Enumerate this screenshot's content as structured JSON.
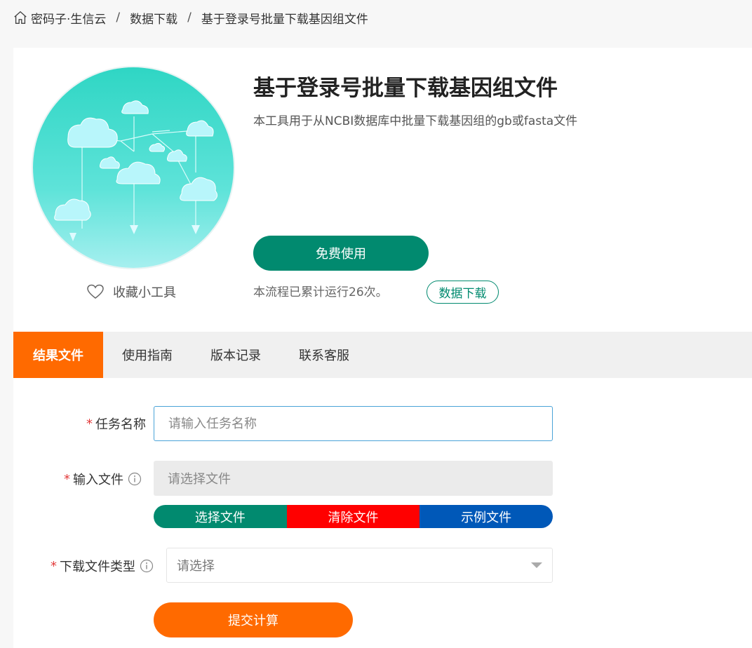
{
  "breadcrumb": {
    "items": [
      "密码子·生信云",
      "数据下载",
      "基于登录号批量下载基因组文件"
    ],
    "separator": "/"
  },
  "tool": {
    "title": "基于登录号批量下载基因组文件",
    "description": "本工具用于从NCBI数据库中批量下载基因组的gb或fasta文件",
    "use_button": "免费使用",
    "run_count": "本流程已累计运行26次。",
    "category_tag": "数据下载",
    "favorite_label": "收藏小工具"
  },
  "tabs": [
    {
      "label": "结果文件",
      "active": true
    },
    {
      "label": "使用指南",
      "active": false
    },
    {
      "label": "版本记录",
      "active": false
    },
    {
      "label": "联系客服",
      "active": false
    }
  ],
  "form": {
    "required_mark": "*",
    "task_name": {
      "label": "任务名称",
      "placeholder": "请输入任务名称",
      "value": ""
    },
    "input_file": {
      "label": "输入文件",
      "placeholder": "请选择文件",
      "info_icon": "info-icon"
    },
    "file_buttons": {
      "select": "选择文件",
      "clear": "清除文件",
      "example": "示例文件"
    },
    "download_type": {
      "label": "下载文件类型",
      "placeholder": "请选择",
      "info_icon": "info-icon"
    },
    "submit": "提交计算"
  },
  "colors": {
    "primary_green": "#018a6f",
    "accent_orange": "#ff6a00",
    "clear_red": "#ff0000",
    "example_blue": "#0058b8"
  }
}
